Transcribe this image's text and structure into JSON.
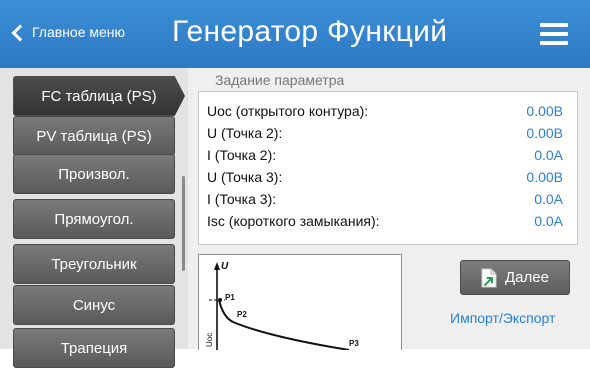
{
  "header": {
    "back_label": "Главное меню",
    "title": "Генератор Функций"
  },
  "sidebar": {
    "tabs": [
      {
        "label": "FC таблица (PS)",
        "active": true
      },
      {
        "label": "PV таблица (PS)",
        "active": false
      },
      {
        "label": "Произвол.",
        "active": false
      },
      {
        "label": "Прямоугол.",
        "active": false
      },
      {
        "label": "Треугольник",
        "active": false
      },
      {
        "label": "Синус",
        "active": false
      },
      {
        "label": "Трапеция",
        "active": false
      }
    ]
  },
  "params": {
    "section_label": "Задание параметра",
    "rows": [
      {
        "label": "Uoc (открытого контура):",
        "value": "0.00В"
      },
      {
        "label": "U (Точка 2):",
        "value": "0.00В"
      },
      {
        "label": "I (Точка 2):",
        "value": "0.0А"
      },
      {
        "label": "U (Точка 3):",
        "value": "0.00В"
      },
      {
        "label": "I (Точка 3):",
        "value": "0.0А"
      },
      {
        "label": "Isc (короткого замыкания):",
        "value": "0.0А"
      }
    ]
  },
  "graph": {
    "y_axis_label": "U",
    "uoc_label": "Uoc",
    "points": [
      "P1",
      "P2",
      "P3"
    ]
  },
  "actions": {
    "next_label": "Далее",
    "import_export_label": "Импорт/Экспорт"
  },
  "colors": {
    "header": "#2d79c4",
    "accent_value": "#2a7fd4",
    "tab": "#5a5a5a"
  }
}
